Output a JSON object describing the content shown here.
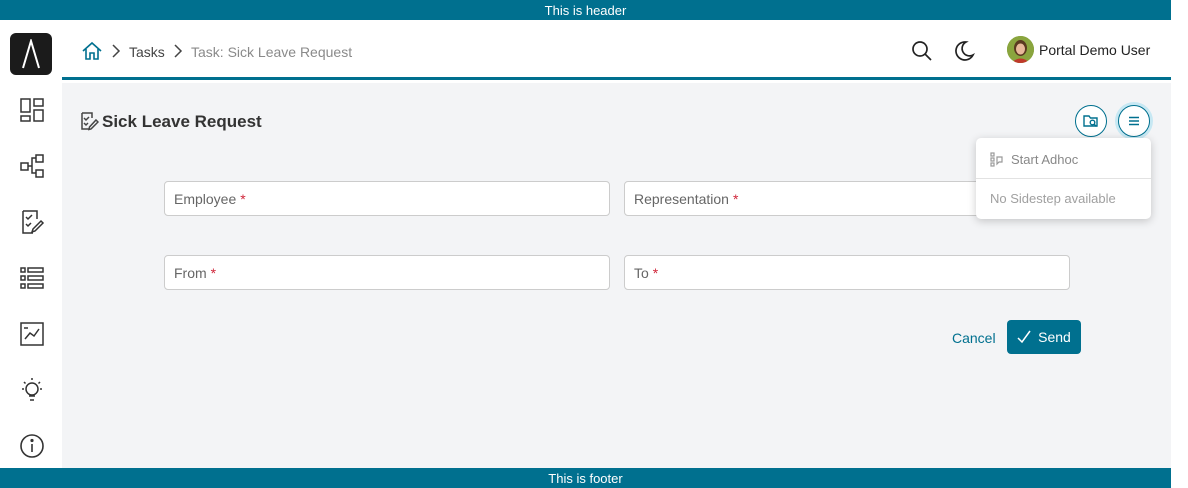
{
  "header_banner": "This is header",
  "footer_banner": "This is footer",
  "sidebar": {
    "logo_icon": "lambda-logo-icon",
    "items": [
      {
        "icon": "dashboard-icon"
      },
      {
        "icon": "process-model-icon"
      },
      {
        "icon": "task-list-icon"
      },
      {
        "icon": "list-icon"
      },
      {
        "icon": "statistics-icon"
      },
      {
        "icon": "idea-bulb-icon"
      },
      {
        "icon": "info-icon"
      }
    ]
  },
  "breadcrumb": {
    "home_icon": "home-icon",
    "items": [
      "Tasks",
      "Task: Sick Leave Request"
    ]
  },
  "topbar": {
    "search_icon": "search-icon",
    "theme_icon": "moon-icon",
    "user_name": "Portal Demo User"
  },
  "page": {
    "title": "Sick Leave Request"
  },
  "form": {
    "fields": [
      {
        "label": "Employee",
        "required": "*"
      },
      {
        "label": "Representation",
        "required": "*"
      },
      {
        "label": "From",
        "required": "*"
      },
      {
        "label": "To",
        "required": "*"
      }
    ],
    "cancel_label": "Cancel",
    "send_label": "Send"
  },
  "menu_dropdown": {
    "start_adhoc": "Start Adhoc",
    "no_sidestep": "No Sidestep available"
  },
  "colors": {
    "primary": "#00708f",
    "required": "#d0263a",
    "background": "#f3f4f6"
  }
}
